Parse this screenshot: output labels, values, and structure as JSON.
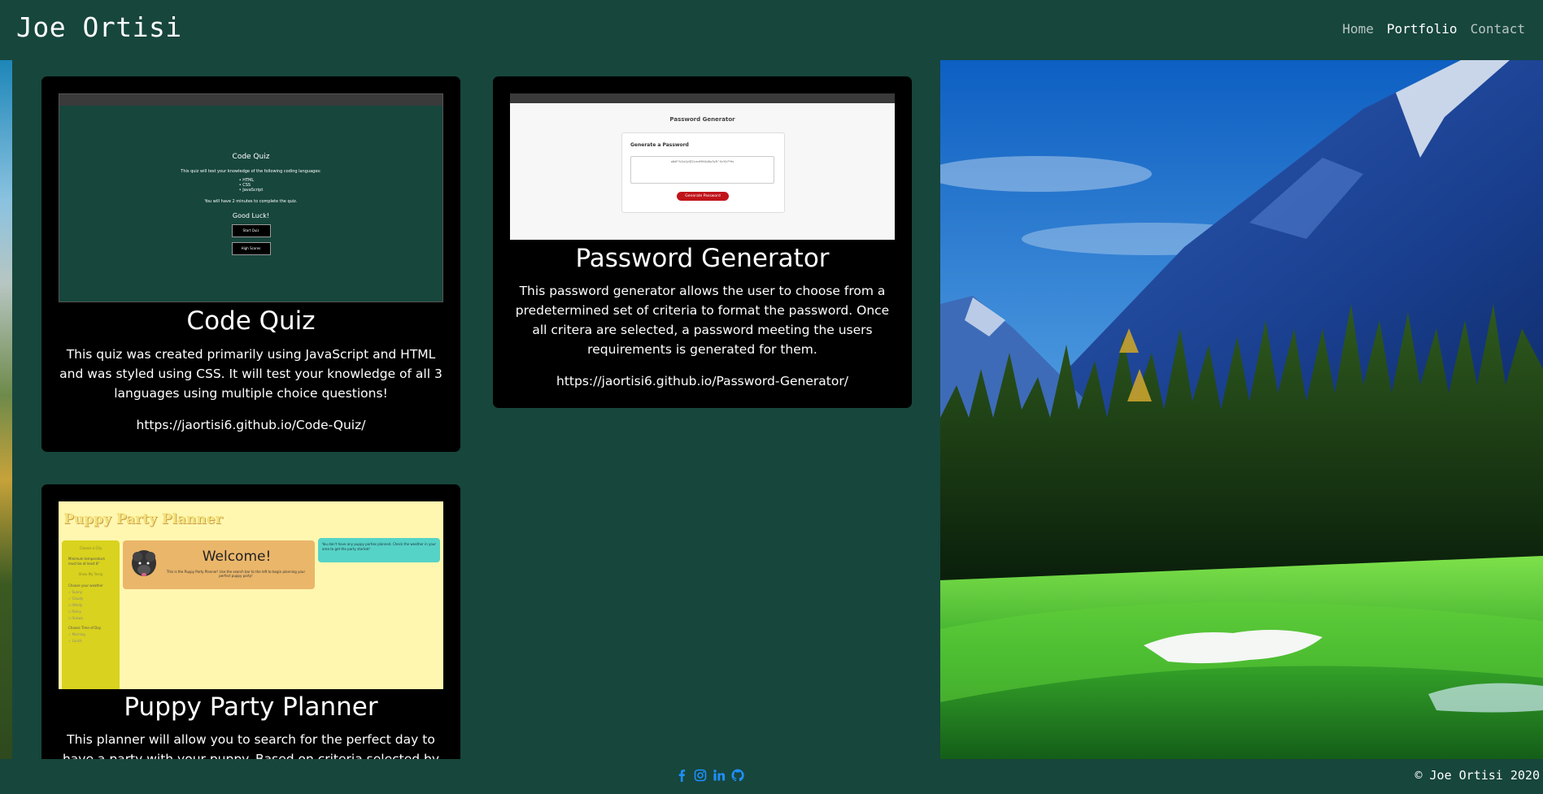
{
  "header": {
    "brand": "Joe Ortisi",
    "nav": [
      {
        "label": "Home",
        "active": false
      },
      {
        "label": "Portfolio",
        "active": true
      },
      {
        "label": "Contact",
        "active": false
      }
    ]
  },
  "cards": [
    {
      "title": "Code Quiz",
      "description": "This quiz was created primarily using JavaScript and HTML and was styled using CSS. It will test your knowledge of all 3 languages using multiple choice questions!",
      "link": "https://jaortisi6.github.io/Code-Quiz/",
      "screenshot": {
        "heading": "Code Quiz",
        "intro": "This quiz will test your knowledge of the following coding languages:",
        "list": [
          "HTML",
          "CSS",
          "JavaScript"
        ],
        "timer_note": "You will have 2 minutes to complete the quiz.",
        "good_luck": "Good Luck!",
        "start_button": "Start Quiz",
        "scores_button": "High Scores"
      }
    },
    {
      "title": "Password Generator",
      "description": "This password generator allows the user to choose from a predetermined set of criteria to format the password. Once all critera are selected, a password meeting the users requirements is generated for them.",
      "link": "https://jaortisi6.github.io/Password-Generator/",
      "screenshot": {
        "page_title": "Password Generator",
        "card_title": "Generate a Password",
        "password_sample": "a8dF!%5xQz@2Lm#9Kt&Wp3vR^0nYb7*Hs",
        "button": "Generate Password"
      }
    },
    {
      "title": "Puppy Party Planner",
      "description": "This planner will allow you to search for the perfect day to have a party with your puppy. Based on criteria selected by the user, a list",
      "screenshot": {
        "app_title": "Puppy Party Planner",
        "welcome": "Welcome!",
        "welcome_sub": "This is the Puppy Party Planner! Use the search bar to the left to begin planning your perfect puppy party!",
        "notice": "You don't have any puppy parties planned. Check the weather in your area to get the party started!",
        "sidebar": [
          "Choose a City",
          "Minimum temperature must be at least 8°",
          "Show My Temp",
          "Choose your weather",
          "Sunny",
          "Cloudy",
          "Windy",
          "Rainy",
          "Snowy",
          "Choose Time of Day",
          "Morning",
          "Lunch"
        ]
      }
    }
  ],
  "footer": {
    "social_icons": [
      "facebook-icon",
      "instagram-icon",
      "linkedin-icon",
      "github-icon"
    ],
    "copyright": "© Joe Ortisi 2020"
  },
  "colors": {
    "page_bg": "#17463c",
    "card_bg": "#000000",
    "social_blue": "#1e90ff",
    "pwd_button": "#c0141b",
    "puppy_yellow": "#fff7b0",
    "puppy_sidebar": "#d9d21e",
    "puppy_welcome": "#eab66a",
    "puppy_notice": "#56d3c7"
  }
}
